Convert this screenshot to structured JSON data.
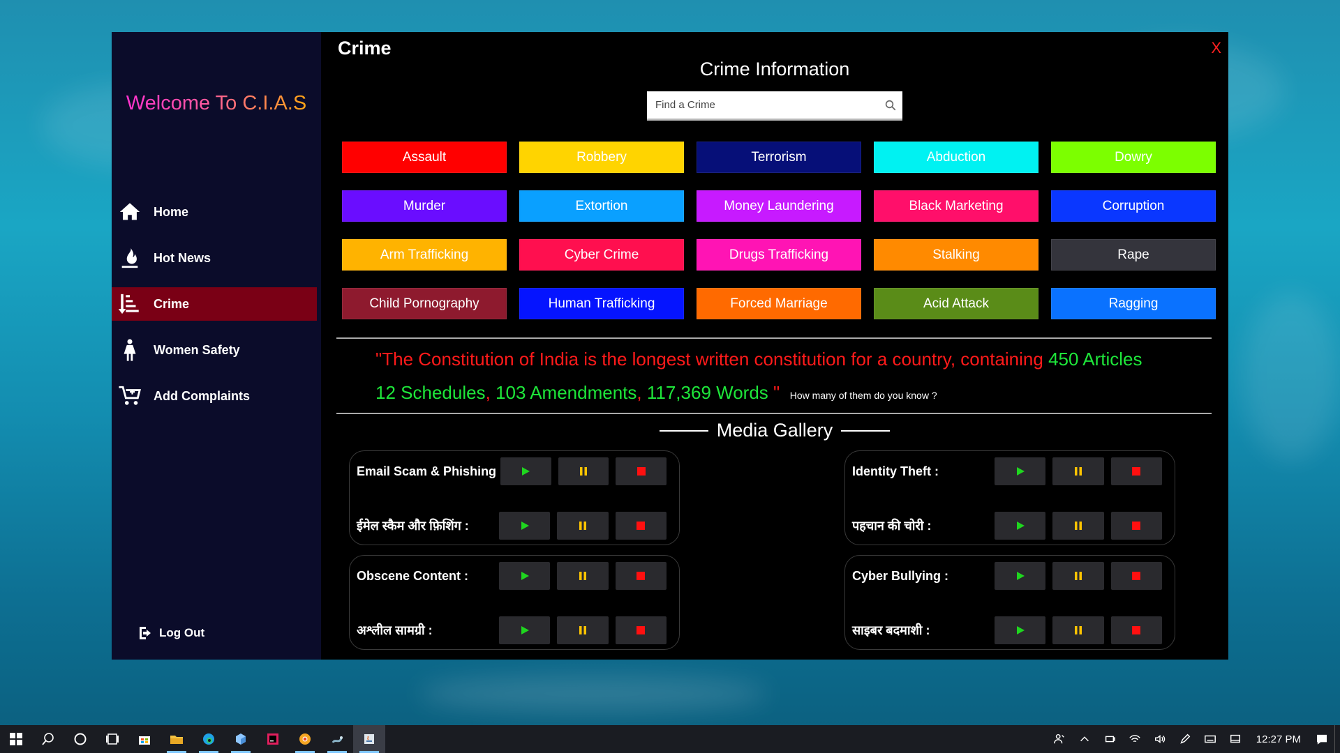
{
  "sidebar": {
    "welcome": "Welcome To C.I.A.S",
    "items": [
      {
        "label": "Home",
        "icon": "home-icon"
      },
      {
        "label": "Hot News",
        "icon": "flame-icon"
      },
      {
        "label": "Crime",
        "icon": "sort-list-icon",
        "active": true
      },
      {
        "label": "Women Safety",
        "icon": "woman-icon"
      },
      {
        "label": "Add Complaints",
        "icon": "cart-add-icon"
      }
    ],
    "logout": "Log Out"
  },
  "main": {
    "title": "Crime",
    "close": "X",
    "info_title": "Crime Information",
    "search_placeholder": "Find a Crime",
    "crimes": [
      {
        "label": "Assault",
        "color": "#ff0000",
        "text": "#ffffff"
      },
      {
        "label": "Robbery",
        "color": "#ffd400",
        "text": "#ffffff"
      },
      {
        "label": "Terrorism",
        "color": "#060f78",
        "text": "#ffffff"
      },
      {
        "label": "Abduction",
        "color": "#00f2f2",
        "text": "#ffffff"
      },
      {
        "label": "Dowry",
        "color": "#7cff00",
        "text": "#ffffff"
      },
      {
        "label": "Murder",
        "color": "#6a0dff",
        "text": "#ffffff"
      },
      {
        "label": "Extortion",
        "color": "#0aa0ff",
        "text": "#ffffff"
      },
      {
        "label": "Money Laundering",
        "color": "#c71aff",
        "text": "#ffffff"
      },
      {
        "label": "Black Marketing",
        "color": "#ff0f6a",
        "text": "#ffffff"
      },
      {
        "label": "Corruption",
        "color": "#0a37ff",
        "text": "#ffffff"
      },
      {
        "label": "Arm Trafficking",
        "color": "#ffb300",
        "text": "#ffffff"
      },
      {
        "label": "Cyber Crime",
        "color": "#ff0f4f",
        "text": "#ffffff"
      },
      {
        "label": "Drugs Trafficking",
        "color": "#ff14b4",
        "text": "#ffffff"
      },
      {
        "label": "Stalking",
        "color": "#ff8a00",
        "text": "#ffffff"
      },
      {
        "label": "Rape",
        "color": "#34343c",
        "text": "#ffffff"
      },
      {
        "label": "Child Pornography",
        "color": "#8e1a2e",
        "text": "#ffffff"
      },
      {
        "label": "Human Trafficking",
        "color": "#0514ff",
        "text": "#ffffff"
      },
      {
        "label": "Forced Marriage",
        "color": "#ff6a00",
        "text": "#ffffff"
      },
      {
        "label": "Acid Attack",
        "color": "#5a8c18",
        "text": "#ffffff"
      },
      {
        "label": "Ragging",
        "color": "#0a72ff",
        "text": "#ffffff"
      }
    ],
    "quote": {
      "part1": "\"The Constitution of India is the longest written constitution for a country, containing",
      "articles": "450 Articles",
      "schedules": "12 Schedules",
      "sep1": ",",
      "amendments": "103 Amendments",
      "sep2": ",",
      "words": "117,369 Words",
      "end": "\"",
      "ask": "How many of them do you know ?"
    },
    "gallery": {
      "title": "Media Gallery",
      "cards": [
        {
          "en": "Email Scam & Phishing :",
          "hi": "ईमेल स्कैम और फ़िशिंग :"
        },
        {
          "en": "Identity Theft :",
          "hi": "पहचान की चोरी :"
        },
        {
          "en": "Obscene Content :",
          "hi": "अश्लील सामग्री :"
        },
        {
          "en": "Cyber Bullying :",
          "hi": "साइबर बदमाशी :"
        }
      ]
    }
  },
  "taskbar": {
    "clock": "12:27 PM",
    "apps": [
      "windows-start-icon",
      "search-icon",
      "cortana-icon",
      "task-view-icon",
      "store-icon",
      "file-explorer-icon",
      "edge-icon",
      "box-icon",
      "jetbrains-icon",
      "chrome-icon",
      "snake-icon",
      "java-app-icon"
    ]
  },
  "colors": {
    "play": "#1fd61f",
    "pause": "#ffc400",
    "stop": "#ff1010"
  }
}
